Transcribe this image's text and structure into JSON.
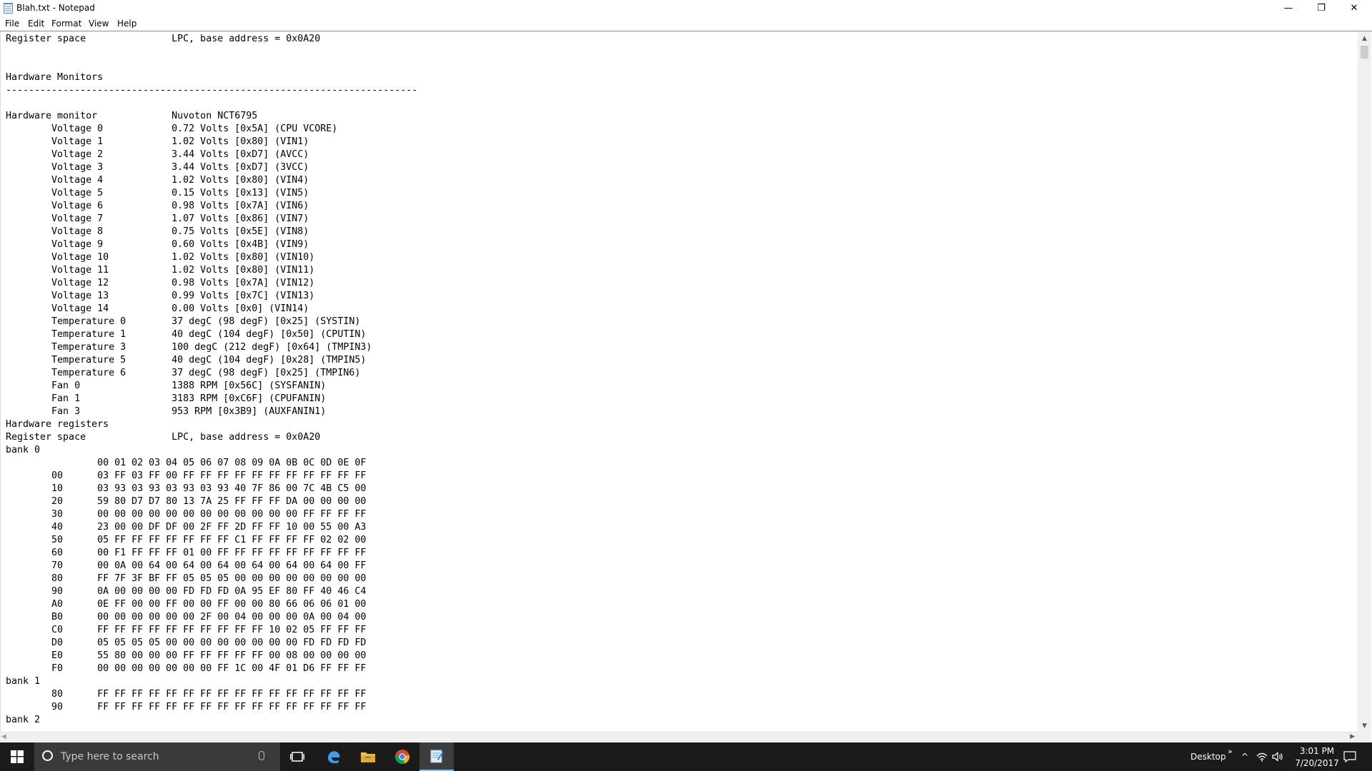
{
  "window": {
    "title": "Blah.txt - Notepad",
    "minimize_glyph": "—",
    "maximize_glyph": "❐",
    "close_glyph": "✕"
  },
  "menu": {
    "items": [
      "File",
      "Edit",
      "Format",
      "View",
      "Help"
    ]
  },
  "editor": {
    "lines": [
      "Register space               LPC, base address = 0x0A20",
      "",
      "",
      "Hardware Monitors",
      "------------------------------------------------------------------------",
      "",
      "Hardware monitor             Nuvoton NCT6795",
      "        Voltage 0            0.72 Volts [0x5A] (CPU VCORE)",
      "        Voltage 1            1.02 Volts [0x80] (VIN1)",
      "        Voltage 2            3.44 Volts [0xD7] (AVCC)",
      "        Voltage 3            3.44 Volts [0xD7] (3VCC)",
      "        Voltage 4            1.02 Volts [0x80] (VIN4)",
      "        Voltage 5            0.15 Volts [0x13] (VIN5)",
      "        Voltage 6            0.98 Volts [0x7A] (VIN6)",
      "        Voltage 7            1.07 Volts [0x86] (VIN7)",
      "        Voltage 8            0.75 Volts [0x5E] (VIN8)",
      "        Voltage 9            0.60 Volts [0x4B] (VIN9)",
      "        Voltage 10           1.02 Volts [0x80] (VIN10)",
      "        Voltage 11           1.02 Volts [0x80] (VIN11)",
      "        Voltage 12           0.98 Volts [0x7A] (VIN12)",
      "        Voltage 13           0.99 Volts [0x7C] (VIN13)",
      "        Voltage 14           0.00 Volts [0x0] (VIN14)",
      "        Temperature 0        37 degC (98 degF) [0x25] (SYSTIN)",
      "        Temperature 1        40 degC (104 degF) [0x50] (CPUTIN)",
      "        Temperature 3        100 degC (212 degF) [0x64] (TMPIN3)",
      "        Temperature 5        40 degC (104 degF) [0x28] (TMPIN5)",
      "        Temperature 6        37 degC (98 degF) [0x25] (TMPIN6)",
      "        Fan 0                1388 RPM [0x56C] (SYSFANIN)",
      "        Fan 1                3183 RPM [0xC6F] (CPUFANIN)",
      "        Fan 3                953 RPM [0x3B9] (AUXFANIN1)",
      "Hardware registers",
      "Register space               LPC, base address = 0x0A20",
      "bank 0",
      "                00 01 02 03 04 05 06 07 08 09 0A 0B 0C 0D 0E 0F",
      "        00      03 FF 03 FF 00 FF FF FF FF FF FF FF FF FF FF FF",
      "        10      03 93 03 93 03 93 03 93 40 7F 86 00 7C 4B C5 00",
      "        20      59 80 D7 D7 80 13 7A 25 FF FF FF DA 00 00 00 00",
      "        30      00 00 00 00 00 00 00 00 00 00 00 00 FF FF FF FF",
      "        40      23 00 00 DF DF 00 2F FF 2D FF FF 10 00 55 00 A3",
      "        50      05 FF FF FF FF FF FF FF C1 FF FF FF FF 02 02 00",
      "        60      00 F1 FF FF FF 01 00 FF FF FF FF FF FF FF FF FF",
      "        70      00 0A 00 64 00 64 00 64 00 64 00 64 00 64 00 FF",
      "        80      FF 7F 3F BF FF 05 05 05 00 00 00 00 00 00 00 00",
      "        90      0A 00 00 00 00 FD FD FD 0A 95 EF 80 FF 40 46 C4",
      "        A0      0E FF 00 00 FF 00 00 FF 00 00 80 66 06 06 01 00",
      "        B0      00 00 00 00 00 00 2F 00 04 00 00 00 0A 00 04 00",
      "        C0      FF FF FF FF FF FF FF FF FF FF 10 02 05 FF FF FF",
      "        D0      05 05 05 05 00 00 00 00 00 00 00 00 FD FD FD FD",
      "        E0      55 80 00 00 00 FF FF FF FF FF 00 08 00 00 00 00",
      "        F0      00 00 00 00 00 00 00 FF 1C 00 4F 01 D6 FF FF FF",
      "bank 1",
      "        80      FF FF FF FF FF FF FF FF FF FF FF FF FF FF FF FF",
      "        90      FF FF FF FF FF FF FF FF FF FF FF FF FF FF FF FF",
      "bank 2"
    ]
  },
  "taskbar": {
    "search_placeholder": "Type here to search",
    "apps": [
      "task-view-icon",
      "edge-icon",
      "file-explorer-icon",
      "chrome-icon",
      "notepad-icon"
    ],
    "desktop_label": "Desktop",
    "overflow_glyph": "»",
    "chevron_glyph": "^",
    "time": "3:01 PM",
    "date": "7/20/2017"
  },
  "colors": {
    "accent": "#4a9fd8",
    "taskbar": "#1b1b1b",
    "search_box": "#3a3a3a",
    "active_app": "#76b9ed"
  }
}
